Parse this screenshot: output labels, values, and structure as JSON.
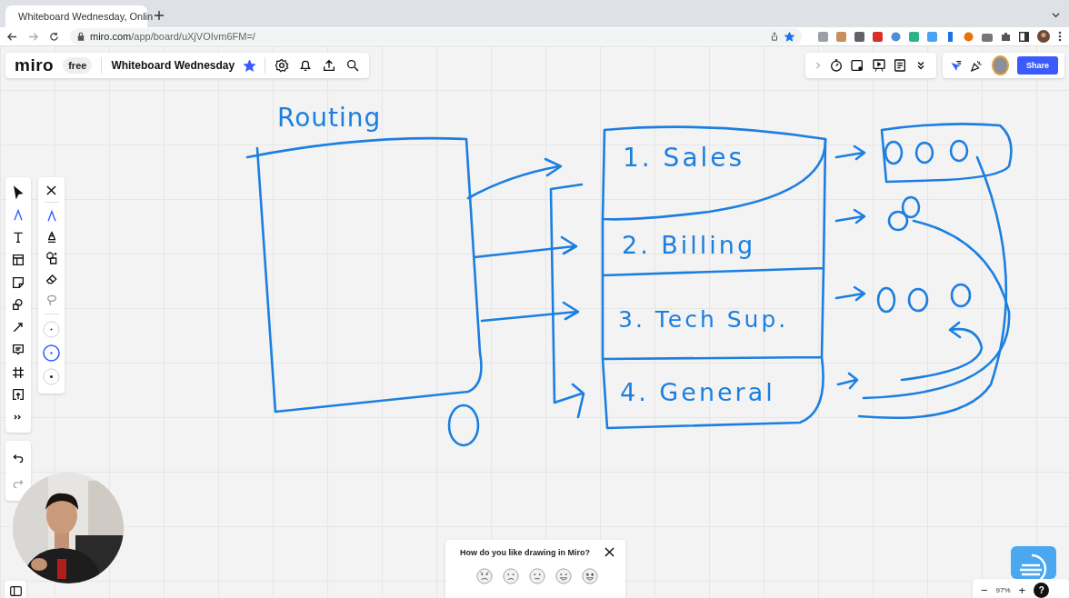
{
  "browser": {
    "tab_title": "Whiteboard Wednesday, Onlin",
    "url_host": "miro.com",
    "url_path": "/app/board/uXjVOIvm6FM=/",
    "bookmarked": true
  },
  "board_header": {
    "logo": "miro",
    "plan": "free",
    "title": "Whiteboard Wednesday",
    "starred": true
  },
  "collab_bar": {
    "share": "Share"
  },
  "toolbar": {
    "tools": [
      {
        "kind": "select",
        "selected": false
      },
      {
        "kind": "pen",
        "selected": true
      },
      {
        "kind": "text",
        "selected": false
      },
      {
        "kind": "template",
        "selected": false
      },
      {
        "kind": "sticky",
        "selected": false
      },
      {
        "kind": "shapes",
        "selected": false
      },
      {
        "kind": "arrow",
        "selected": false
      },
      {
        "kind": "comment",
        "selected": false
      },
      {
        "kind": "frame",
        "selected": false
      },
      {
        "kind": "upload",
        "selected": false
      },
      {
        "kind": "more",
        "selected": false
      }
    ]
  },
  "pen_panel": {
    "tools": [
      {
        "kind": "pen",
        "selected": true
      },
      {
        "kind": "marker",
        "selected": false
      },
      {
        "kind": "smart",
        "selected": false
      },
      {
        "kind": "eraser",
        "selected": false
      },
      {
        "kind": "lasso",
        "selected": false
      }
    ],
    "sizes": [
      {
        "selected": false
      },
      {
        "selected": true
      },
      {
        "selected": false
      }
    ]
  },
  "canvas_labels": [
    {
      "text": "Routing",
      "kind": "title"
    },
    {
      "text": "1. Sales",
      "kind": "row"
    },
    {
      "text": "2. Billing",
      "kind": "row"
    },
    {
      "text": "3. Tech Sup.",
      "kind": "row"
    },
    {
      "text": "4. General",
      "kind": "row"
    }
  ],
  "survey": {
    "question": "How do you like drawing in Miro?"
  },
  "zoom": {
    "minus": "−",
    "level": "97%",
    "plus": "+",
    "help": "?"
  }
}
